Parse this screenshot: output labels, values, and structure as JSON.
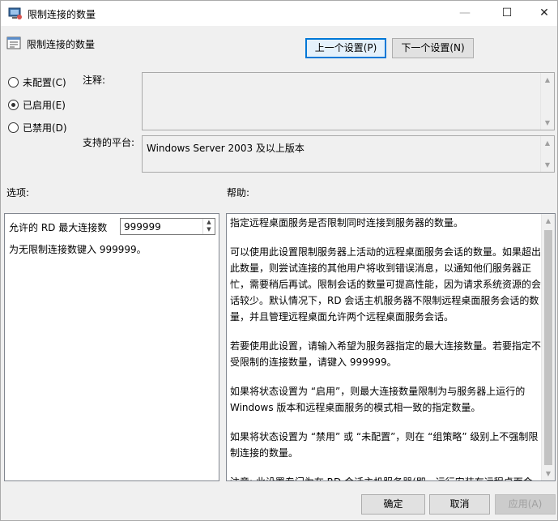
{
  "window": {
    "title": "限制连接的数量",
    "controls": {
      "minimize": "—",
      "maximize": "☐",
      "close": "✕"
    }
  },
  "header": {
    "title": "限制连接的数量",
    "prev_button": "上一个设置(P)",
    "next_button": "下一个设置(N)"
  },
  "state": {
    "options": [
      {
        "label": "未配置(C)",
        "selected": false
      },
      {
        "label": "已启用(E)",
        "selected": true
      },
      {
        "label": "已禁用(D)",
        "selected": false
      }
    ]
  },
  "comment": {
    "label": "注释:",
    "value": ""
  },
  "platform": {
    "label": "支持的平台:",
    "value": "Windows Server 2003 及以上版本"
  },
  "options_section": {
    "label": "选项:",
    "max_connections_label": "允许的 RD 最大连接数",
    "max_connections_value": "999999",
    "hint": "为无限制连接数键入 999999。"
  },
  "help_section": {
    "label": "帮助:",
    "paragraphs": [
      "指定远程桌面服务是否限制同时连接到服务器的数量。",
      "可以使用此设置限制服务器上活动的远程桌面服务会话的数量。如果超出此数量，则尝试连接的其他用户将收到错误消息，以通知他们服务器正忙，需要稍后再试。限制会话的数量可提高性能，因为请求系统资源的会话较少。默认情况下，RD 会话主机服务器不限制远程桌面服务会话的数量，并且管理远程桌面允许两个远程桌面服务会话。",
      "若要使用此设置，请输入希望为服务器指定的最大连接数量。若要指定不受限制的连接数量，请键入 999999。",
      "如果将状态设置为 “启用”，则最大连接数量限制为与服务器上运行的 Windows 版本和远程桌面服务的模式相一致的指定数量。",
      "如果将状态设置为 “禁用” 或 “未配置”，则在 “组策略” 级别上不强制限制连接的数量。",
      "注意: 此设置专门为在 RD 会话主机服务器(即，运行安装有远程桌面会话主机角色服务的 Windows 的服务器)上使用而设计。"
    ]
  },
  "footer": {
    "ok": "确定",
    "cancel": "取消",
    "apply": "应用(A)"
  }
}
